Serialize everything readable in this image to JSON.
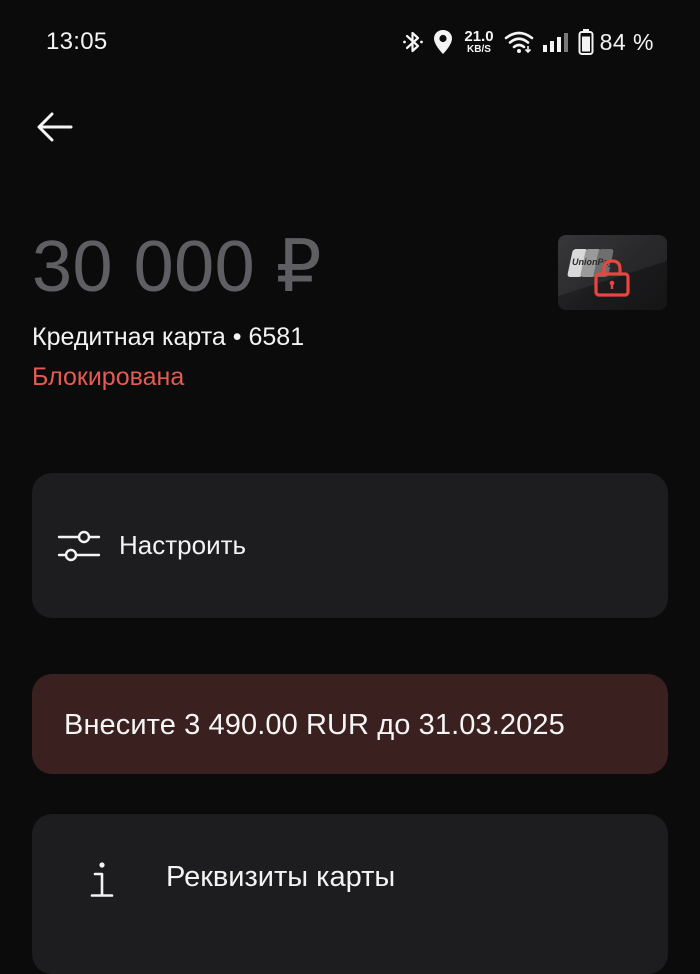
{
  "status_bar": {
    "time": "13:05",
    "net_speed_value": "21.0",
    "net_speed_unit": "KB/S",
    "battery_percent": "84 %",
    "icons": [
      "bluetooth-icon",
      "location-icon",
      "wifi-icon",
      "signal-icon",
      "battery-icon"
    ]
  },
  "header": {
    "back_icon": "arrow-left-icon"
  },
  "card": {
    "balance": "30 000 ₽",
    "name": "Кредитная карта • 6581",
    "status": "Блокирована",
    "status_color": "#e45a54",
    "thumbnail_brand": "UnionPay",
    "thumbnail_icon": "lock-icon"
  },
  "actions": {
    "settings_label": "Настроить",
    "settings_icon": "sliders-icon",
    "payment_notice": "Внесите 3 490.00 RUR до 31.03.2025",
    "details_label": "Реквизиты карты",
    "details_icon": "info-icon"
  },
  "colors": {
    "background": "#0c0b0b",
    "tile": "#1d1c1e",
    "payment_tile": "#3b2020",
    "accent_red": "#e45a54"
  }
}
